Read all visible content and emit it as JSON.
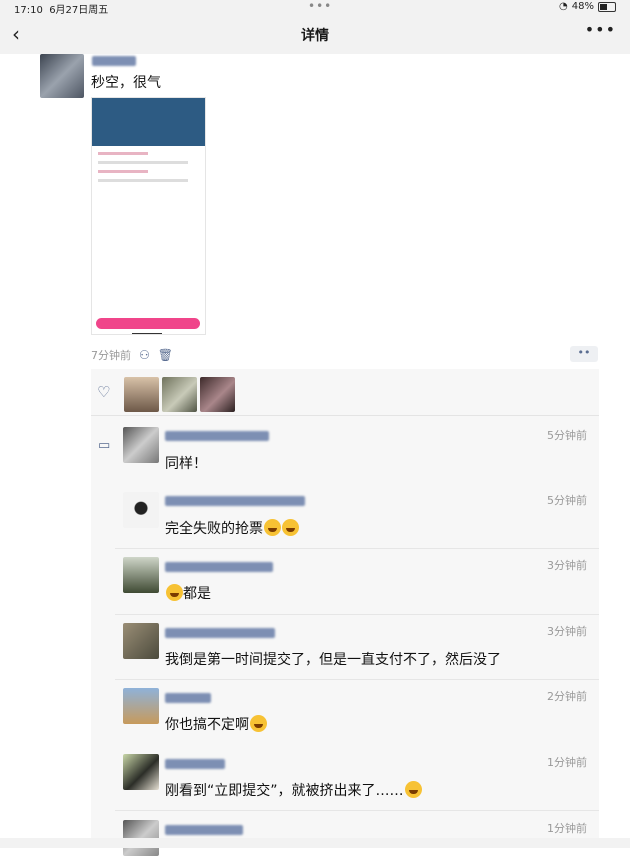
{
  "status": {
    "time": "17:10",
    "date": "6月27日周五",
    "battery": "48%"
  },
  "nav": {
    "back": "‹",
    "title": "详情",
    "more": "•••"
  },
  "post": {
    "text": "秒空，很气",
    "time": "7分钟前",
    "more": "••"
  },
  "comments": [
    {
      "time": "5分钟前",
      "text": "同样！"
    },
    {
      "time": "5分钟前",
      "text": "完全失败的抢票"
    },
    {
      "time": "3分钟前",
      "text": "都是"
    },
    {
      "time": "3分钟前",
      "text": "我倒是第一时间提交了，但是一直支付不了，然后没了"
    },
    {
      "time": "2分钟前",
      "text": "你也搞不定啊"
    },
    {
      "time": "1分钟前",
      "text": "刚看到“立即提交”，就被挤出来了……"
    },
    {
      "time": "1分钟前",
      "text": ""
    }
  ],
  "icons": {
    "back": "chevron-left-icon",
    "more": "more-icon",
    "heart": "heart-icon",
    "comment": "comment-icon",
    "person": "person-icon",
    "trash": "trash-icon"
  },
  "colors": {
    "accent": "#5a6d91",
    "background": "#f7f7f7",
    "navbar": "#f2f2f2"
  }
}
